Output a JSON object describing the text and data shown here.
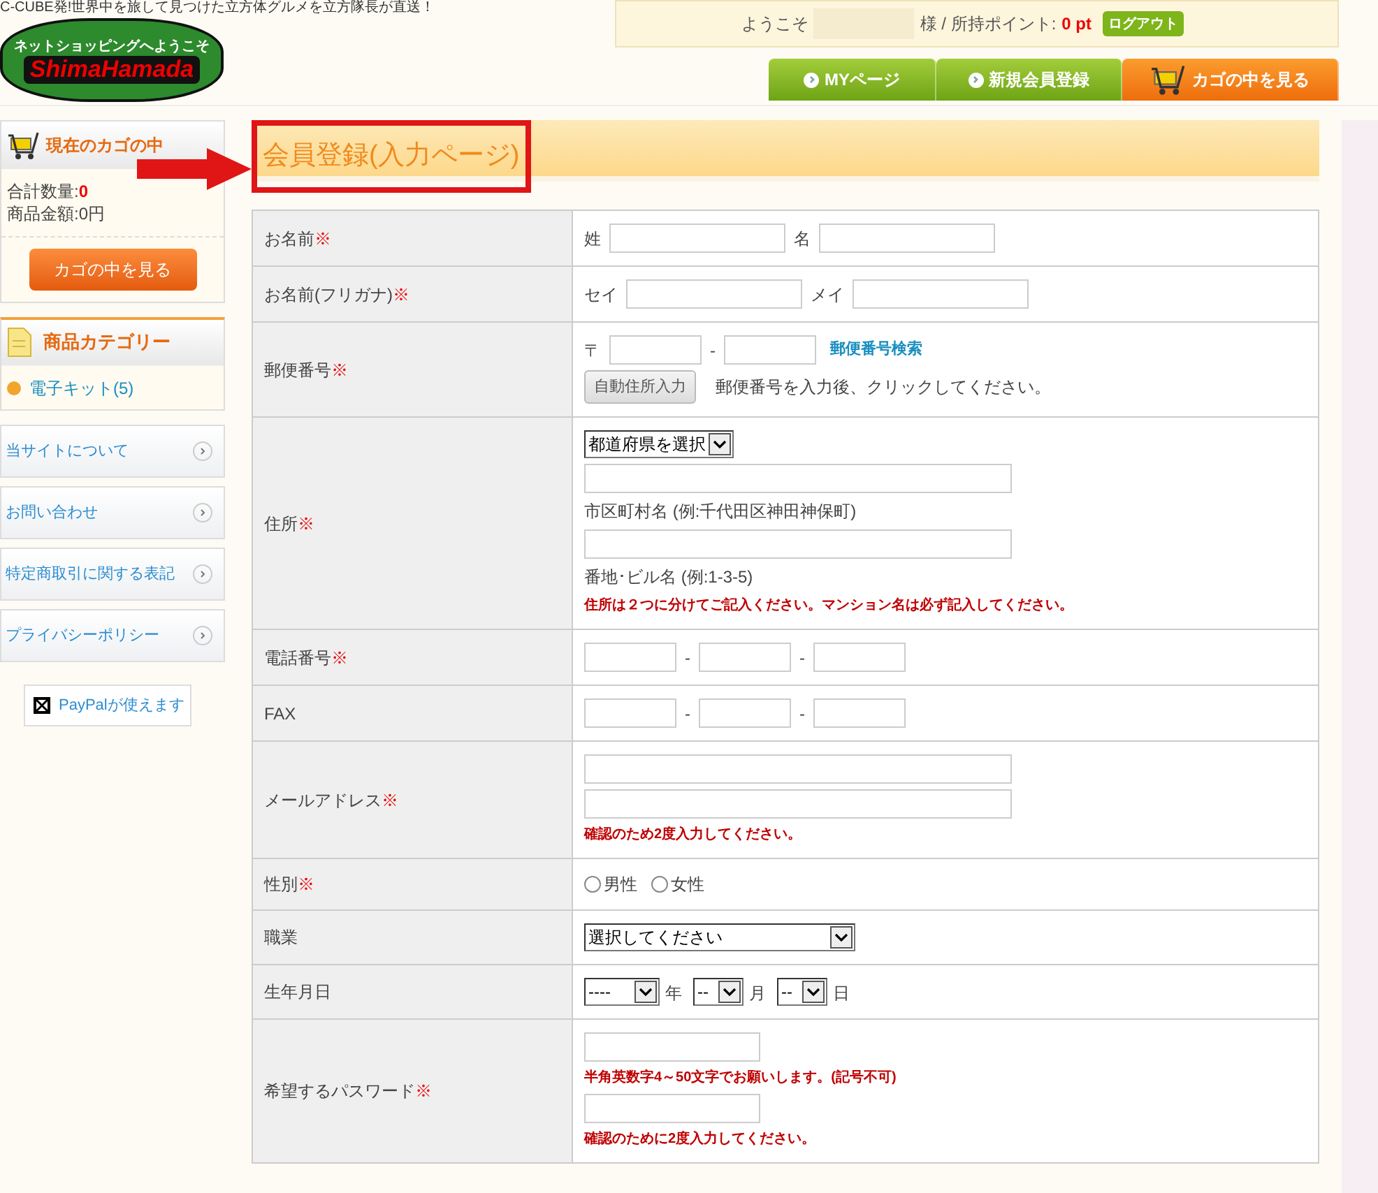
{
  "header": {
    "tagline": "C-CUBE発!世界中を旅して見つけた立方体グルメを立方隊長が直送！",
    "logo": {
      "line1": "ネットショッピングへようこそ",
      "line2": "ShimaHamada"
    },
    "welcome": {
      "greeting": "ようこそ",
      "suffix": "様 / 所持ポイント:",
      "points": "0 pt",
      "logout": "ログアウト"
    },
    "nav": [
      {
        "label": "MYページ",
        "kind": "link"
      },
      {
        "label": "新規会員登録",
        "kind": "link"
      },
      {
        "label": "カゴの中を見る",
        "kind": "cart"
      }
    ]
  },
  "sidebar": {
    "cart": {
      "title": "現在のカゴの中",
      "lines": [
        {
          "label": "合計数量:",
          "value": "0",
          "highlight": true
        },
        {
          "label": "商品金額:",
          "value": "0円",
          "highlight": false
        }
      ],
      "button": "カゴの中を見る"
    },
    "category": {
      "title": "商品カテゴリー",
      "items": [
        "電子キット(5)"
      ]
    },
    "links": [
      "当サイトについて",
      "お問い合わせ",
      "特定商取引に関する表記",
      "プライバシーポリシー"
    ],
    "paypal": "PayPalが使えます"
  },
  "page_title": "会員登録(入力ページ)",
  "form": [
    {
      "label": "お名前",
      "required": "※",
      "kind": "name",
      "lines": [
        [
          {
            "kind": "text",
            "text": "姓"
          },
          {
            "kind": "input"
          },
          {
            "kind": "text",
            "text": "名"
          },
          {
            "kind": "input"
          }
        ]
      ]
    },
    {
      "label": "お名前(フリガナ)",
      "required": "※",
      "kind": "name",
      "lines": [
        [
          {
            "kind": "text",
            "text": "セイ"
          },
          {
            "kind": "input"
          },
          {
            "kind": "text",
            "text": "メイ"
          },
          {
            "kind": "input"
          }
        ]
      ]
    },
    {
      "label": "郵便番号",
      "required": "※",
      "kind": "postal",
      "lines": [
        [
          {
            "kind": "text",
            "text": "〒"
          },
          {
            "kind": "input"
          },
          {
            "kind": "text",
            "text": "-"
          },
          {
            "kind": "input"
          },
          {
            "kind": "link",
            "text": "郵便番号検索"
          }
        ],
        [
          {
            "kind": "button",
            "text": "自動住所入力"
          },
          {
            "kind": "text",
            "text": "郵便番号を入力後、クリックしてください。"
          }
        ]
      ]
    },
    {
      "label": "住所",
      "required": "※",
      "kind": "address",
      "lines": [
        [
          {
            "kind": "select",
            "text": "都道府県を選択"
          }
        ],
        [
          {
            "kind": "input"
          }
        ],
        [
          {
            "kind": "text",
            "text": "市区町村名 (例:千代田区神田神保町)"
          }
        ],
        [
          {
            "kind": "input"
          }
        ],
        [
          {
            "kind": "text",
            "text": "番地･ビル名 (例:1-3-5)"
          }
        ],
        [
          {
            "kind": "note",
            "text": "住所は２つに分けてご記入ください。マンション名は必ず記入してください。"
          }
        ]
      ]
    },
    {
      "label": "電話番号",
      "required": "※",
      "kind": "phone",
      "lines": [
        [
          {
            "kind": "input"
          },
          {
            "kind": "text",
            "text": "-"
          },
          {
            "kind": "input"
          },
          {
            "kind": "text",
            "text": "-"
          },
          {
            "kind": "input"
          }
        ]
      ]
    },
    {
      "label": "FAX",
      "kind": "phone",
      "lines": [
        [
          {
            "kind": "input"
          },
          {
            "kind": "text",
            "text": "-"
          },
          {
            "kind": "input"
          },
          {
            "kind": "text",
            "text": "-"
          },
          {
            "kind": "input"
          }
        ]
      ]
    },
    {
      "label": "メールアドレス",
      "required": "※",
      "kind": "email",
      "lines": [
        [
          {
            "kind": "input"
          }
        ],
        [
          {
            "kind": "input"
          }
        ],
        [
          {
            "kind": "note",
            "text": "確認のため2度入力してください。"
          }
        ]
      ]
    },
    {
      "label": "性別",
      "required": "※",
      "kind": "gender",
      "lines": [
        [
          {
            "kind": "radio",
            "text": "男性",
            "selected": false
          },
          {
            "kind": "radio",
            "text": "女性",
            "selected": false
          }
        ]
      ]
    },
    {
      "label": "職業",
      "kind": "occupation",
      "lines": [
        [
          {
            "kind": "select",
            "text": "選択してください"
          }
        ]
      ]
    },
    {
      "label": "生年月日",
      "kind": "date",
      "lines": [
        [
          {
            "kind": "select",
            "text": "----"
          },
          {
            "kind": "unit",
            "text": "年"
          },
          {
            "kind": "select",
            "text": "--"
          },
          {
            "kind": "unit",
            "text": "月"
          },
          {
            "kind": "select",
            "text": "--"
          },
          {
            "kind": "unit",
            "text": "日"
          }
        ]
      ]
    },
    {
      "label": "希望するパスワード",
      "required": "※",
      "kind": "password",
      "lines": [
        [
          {
            "kind": "input"
          }
        ],
        [
          {
            "kind": "note",
            "text": "半角英数字4～50文字でお願いします。(記号不可)"
          }
        ],
        [
          {
            "kind": "input"
          }
        ],
        [
          {
            "kind": "note",
            "text": "確認のために2度入力してください。"
          }
        ]
      ]
    }
  ]
}
